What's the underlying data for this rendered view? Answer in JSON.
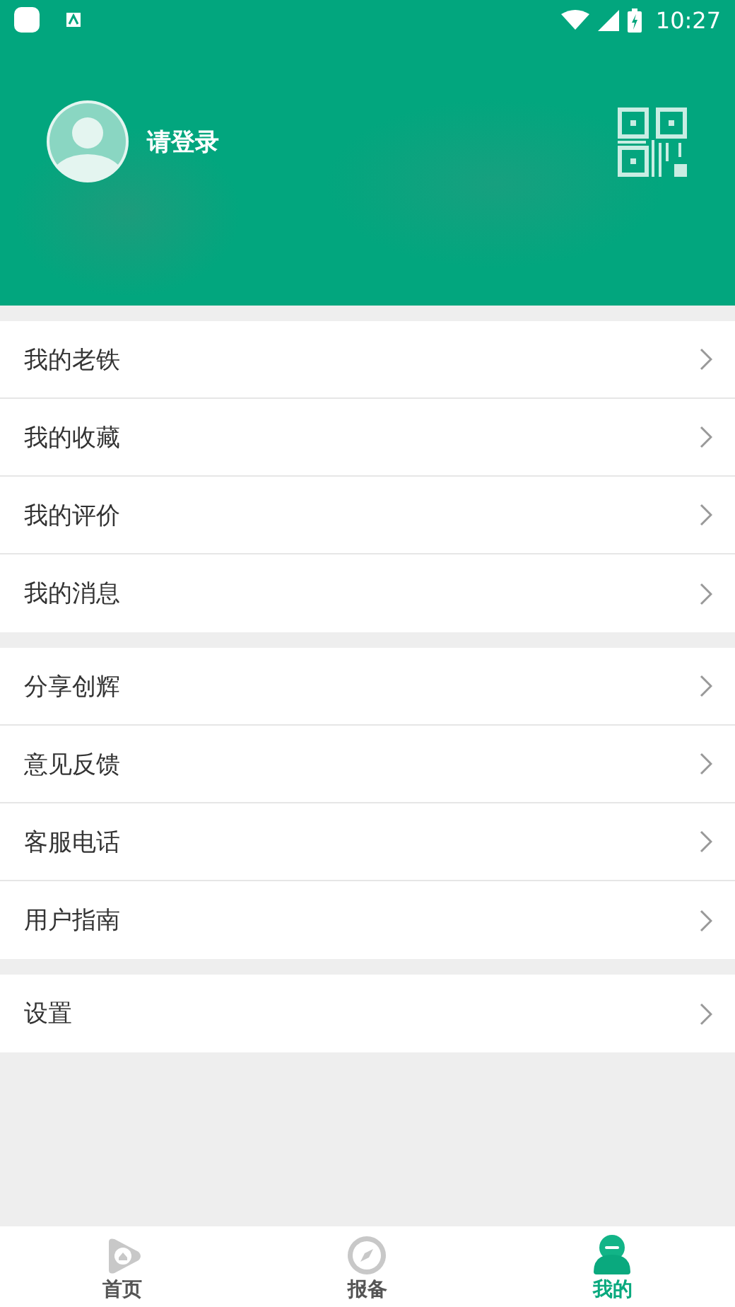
{
  "status_bar": {
    "time": "10:27"
  },
  "profile": {
    "login_label": "请登录"
  },
  "menu_groups": [
    {
      "items": [
        {
          "label": "我的老铁"
        },
        {
          "label": "我的收藏"
        },
        {
          "label": "我的评价"
        },
        {
          "label": "我的消息"
        }
      ]
    },
    {
      "items": [
        {
          "label": "分享创辉"
        },
        {
          "label": "意见反馈"
        },
        {
          "label": "客服电话"
        },
        {
          "label": "用户指南"
        }
      ]
    },
    {
      "items": [
        {
          "label": "设置"
        }
      ]
    }
  ],
  "tabs": [
    {
      "label": "首页",
      "kind": "home",
      "selected": false
    },
    {
      "label": "报备",
      "kind": "compass",
      "selected": false
    },
    {
      "label": "我的",
      "kind": "person",
      "selected": true
    }
  ]
}
